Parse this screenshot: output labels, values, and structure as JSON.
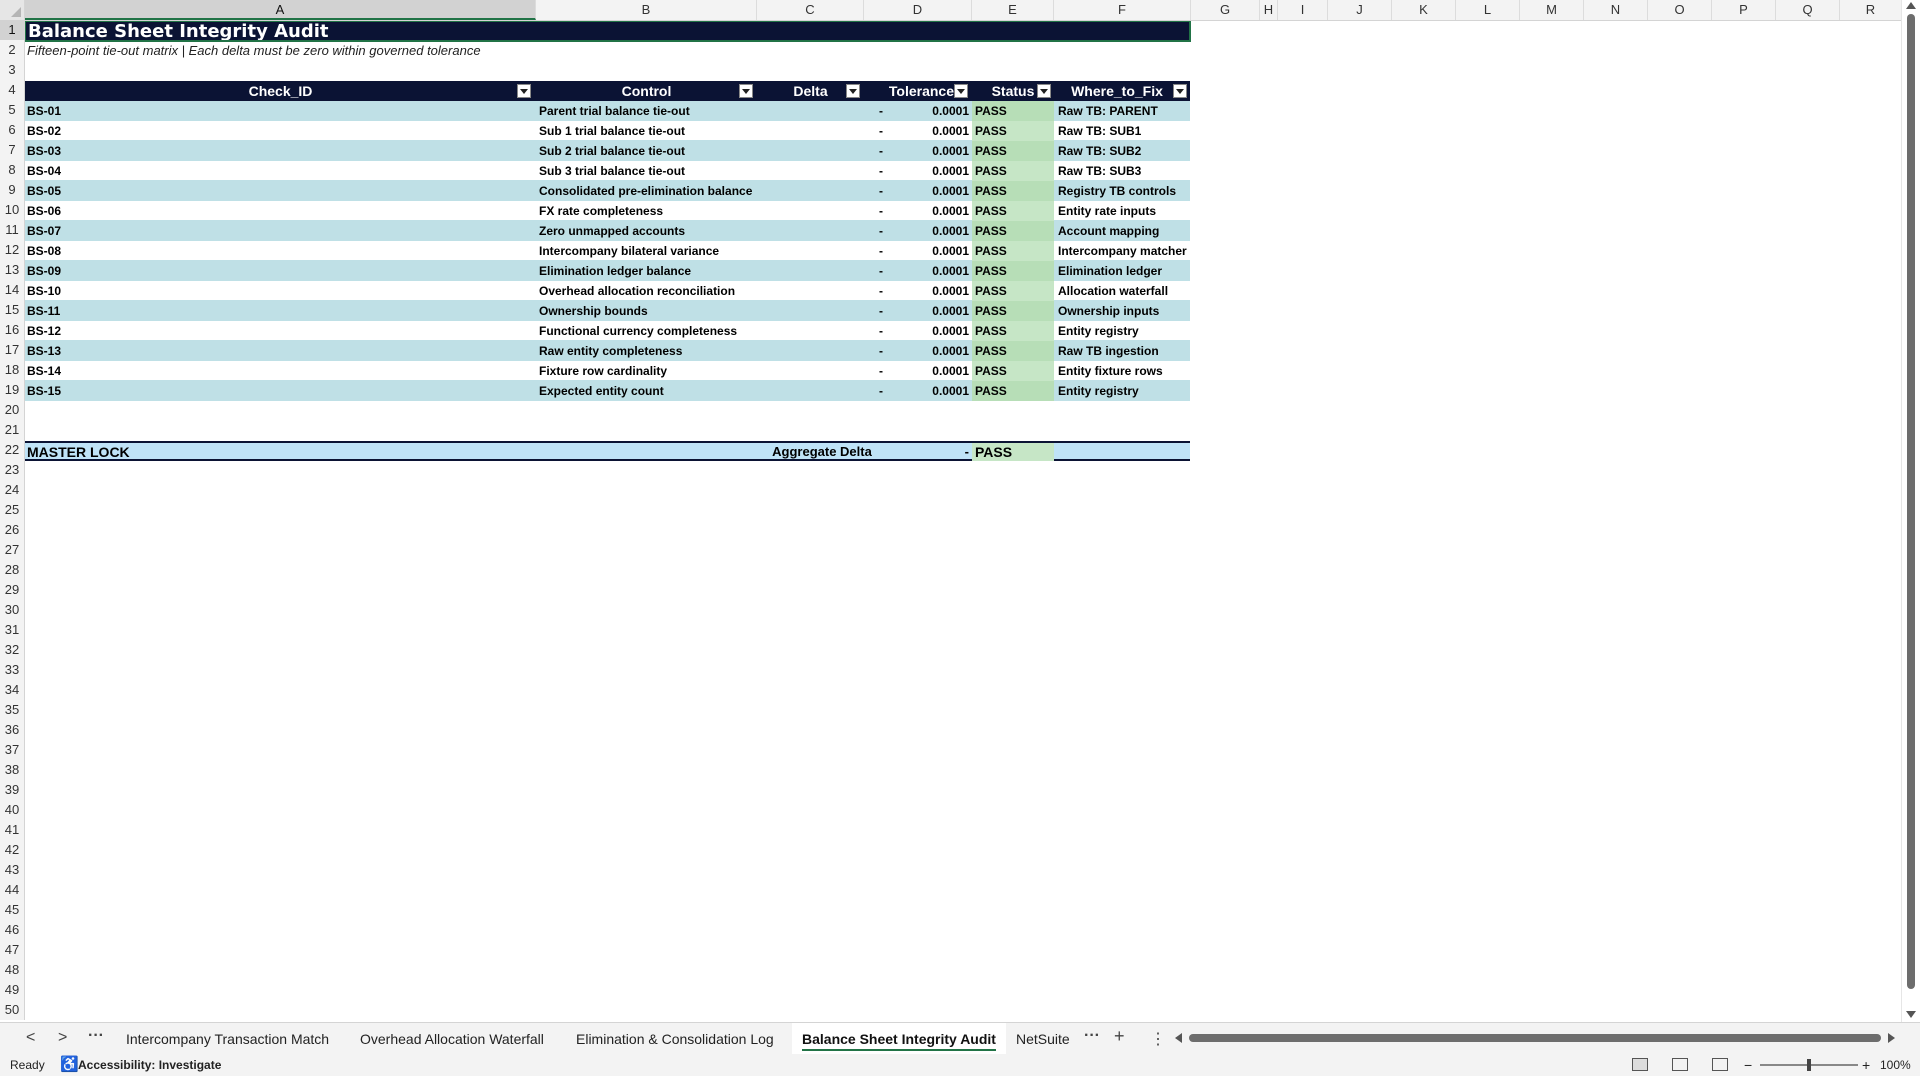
{
  "columns": [
    "A",
    "B",
    "C",
    "D",
    "E",
    "F",
    "G",
    "H",
    "I",
    "J",
    "K",
    "L",
    "M",
    "N",
    "O",
    "P",
    "Q",
    "R"
  ],
  "rows": [
    "1",
    "2",
    "3",
    "4",
    "5",
    "6",
    "7",
    "8",
    "9",
    "10",
    "11",
    "12",
    "13",
    "14",
    "15",
    "16",
    "17",
    "18",
    "19",
    "20",
    "21",
    "22",
    "23",
    "24",
    "25",
    "26",
    "27",
    "28",
    "29",
    "30",
    "31",
    "32",
    "33",
    "34",
    "35",
    "36",
    "37",
    "38",
    "39",
    "40",
    "41",
    "42",
    "43",
    "44",
    "45",
    "46",
    "47",
    "48",
    "49",
    "50"
  ],
  "sheet": {
    "title": "Balance Sheet Integrity Audit",
    "subtitle": "Fifteen-point tie-out matrix | Each delta must be zero within governed tolerance",
    "headers": {
      "check_id": "Check_ID",
      "control": "Control",
      "delta": "Delta",
      "tolerance": "Tolerance",
      "status": "Status",
      "where_to_fix": "Where_to_Fix"
    },
    "checks": [
      {
        "id": "BS-01",
        "control": "Parent trial balance tie-out",
        "delta": "-",
        "tolerance": "0.0001",
        "status": "PASS",
        "fix": "Raw TB: PARENT"
      },
      {
        "id": "BS-02",
        "control": "Sub 1 trial balance tie-out",
        "delta": "-",
        "tolerance": "0.0001",
        "status": "PASS",
        "fix": "Raw TB: SUB1"
      },
      {
        "id": "BS-03",
        "control": "Sub 2 trial balance tie-out",
        "delta": "-",
        "tolerance": "0.0001",
        "status": "PASS",
        "fix": "Raw TB: SUB2"
      },
      {
        "id": "BS-04",
        "control": "Sub 3 trial balance tie-out",
        "delta": "-",
        "tolerance": "0.0001",
        "status": "PASS",
        "fix": "Raw TB: SUB3"
      },
      {
        "id": "BS-05",
        "control": "Consolidated pre-elimination balance",
        "delta": "-",
        "tolerance": "0.0001",
        "status": "PASS",
        "fix": "Registry TB controls"
      },
      {
        "id": "BS-06",
        "control": "FX rate completeness",
        "delta": "-",
        "tolerance": "0.0001",
        "status": "PASS",
        "fix": "Entity rate inputs"
      },
      {
        "id": "BS-07",
        "control": "Zero unmapped accounts",
        "delta": "-",
        "tolerance": "0.0001",
        "status": "PASS",
        "fix": "Account mapping"
      },
      {
        "id": "BS-08",
        "control": "Intercompany bilateral variance",
        "delta": "-",
        "tolerance": "0.0001",
        "status": "PASS",
        "fix": "Intercompany matcher"
      },
      {
        "id": "BS-09",
        "control": "Elimination ledger balance",
        "delta": "-",
        "tolerance": "0.0001",
        "status": "PASS",
        "fix": "Elimination ledger"
      },
      {
        "id": "BS-10",
        "control": "Overhead allocation reconciliation",
        "delta": "-",
        "tolerance": "0.0001",
        "status": "PASS",
        "fix": "Allocation waterfall"
      },
      {
        "id": "BS-11",
        "control": "Ownership bounds",
        "delta": "-",
        "tolerance": "0.0001",
        "status": "PASS",
        "fix": "Ownership inputs"
      },
      {
        "id": "BS-12",
        "control": "Functional currency completeness",
        "delta": "-",
        "tolerance": "0.0001",
        "status": "PASS",
        "fix": "Entity registry"
      },
      {
        "id": "BS-13",
        "control": "Raw entity completeness",
        "delta": "-",
        "tolerance": "0.0001",
        "status": "PASS",
        "fix": "Raw TB ingestion"
      },
      {
        "id": "BS-14",
        "control": "Fixture row cardinality",
        "delta": "-",
        "tolerance": "0.0001",
        "status": "PASS",
        "fix": "Entity fixture rows"
      },
      {
        "id": "BS-15",
        "control": "Expected entity count",
        "delta": "-",
        "tolerance": "0.0001",
        "status": "PASS",
        "fix": "Entity registry"
      }
    ],
    "master": {
      "label": "MASTER LOCK",
      "agg_label": "Aggregate Delta",
      "agg_value": "-",
      "status": "PASS"
    }
  },
  "tabs": {
    "nav_prev": "<",
    "nav_next": ">",
    "more": "···",
    "items": [
      "Intercompany Transaction Match",
      "Overhead Allocation Waterfall",
      "Elimination & Consolidation Log",
      "Balance Sheet Integrity Audit",
      "NetSuite"
    ],
    "active_index": 3,
    "overflow": "···",
    "add": "+",
    "menu": "⋮"
  },
  "statusbar": {
    "ready": "Ready",
    "accessibility": "Accessibility: Investigate",
    "zoom_minus": "−",
    "zoom_plus": "+",
    "zoom": "100%"
  },
  "colors": {
    "header_navy": "#0b1334",
    "band_teal": "#bfe0e6",
    "pass_green": "#c6e6c6",
    "master_blue": "#bfe3f7",
    "excel_green": "#217346"
  }
}
